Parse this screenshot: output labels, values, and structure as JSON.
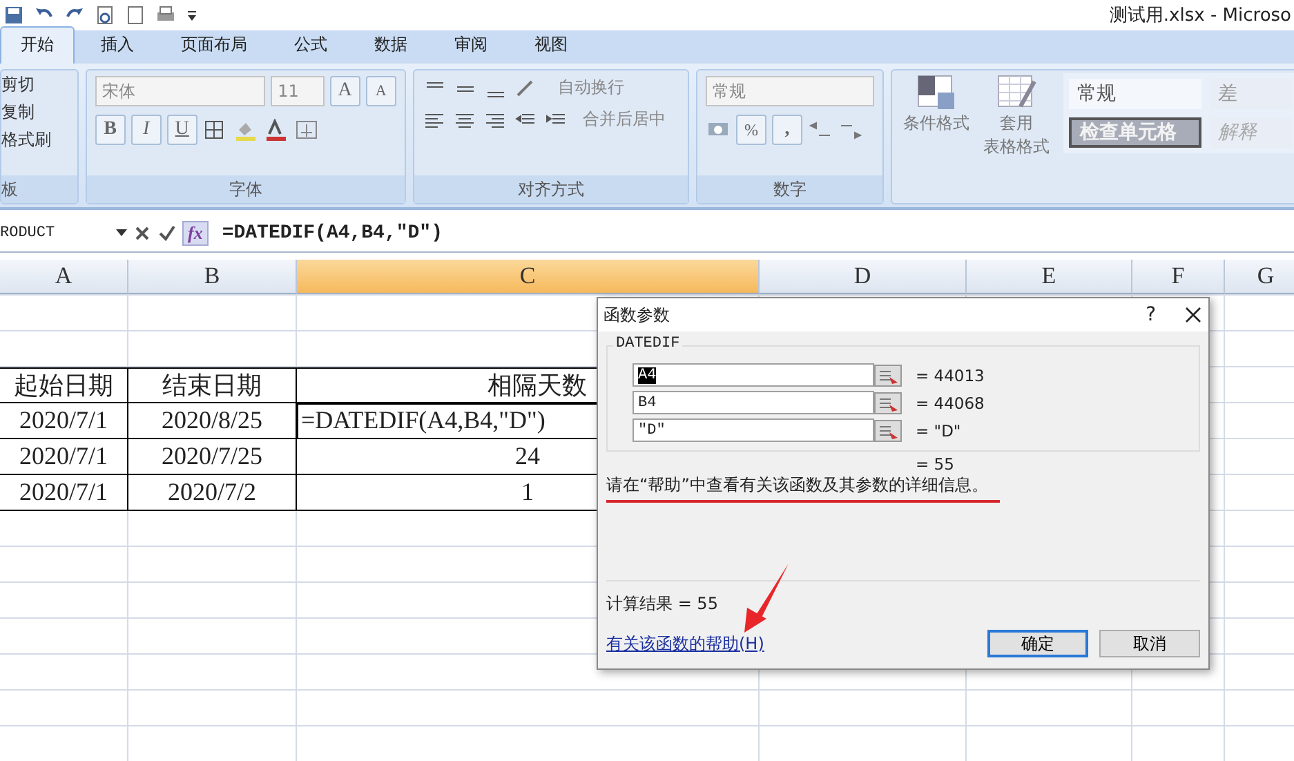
{
  "window": {
    "title": "测试用.xlsx - Microso"
  },
  "tabs": [
    {
      "label": "开始",
      "selected": true
    },
    {
      "label": "插入",
      "selected": false
    },
    {
      "label": "页面布局",
      "selected": false
    },
    {
      "label": "公式",
      "selected": false
    },
    {
      "label": "数据",
      "selected": false
    },
    {
      "label": "审阅",
      "selected": false
    },
    {
      "label": "视图",
      "selected": false
    }
  ],
  "clipboard": {
    "items": [
      "剪切",
      "复制",
      "格式刷"
    ],
    "label": "板"
  },
  "font": {
    "name": "宋体",
    "size": "11",
    "grow": "A",
    "shrink": "A",
    "styles": [
      "B",
      "I",
      "U"
    ],
    "label": "字体"
  },
  "alignment": {
    "wrap": "自动换行",
    "merge": "合并后居中",
    "label": "对齐方式"
  },
  "number": {
    "format": "常规",
    "percent": "%",
    "comma": ",",
    "label": "数字"
  },
  "styles": {
    "conditional": "条件格式",
    "table": [
      "套用",
      "表格格式"
    ],
    "gallery": [
      {
        "label": "常规",
        "kind": "normal"
      },
      {
        "label": "差",
        "kind": "bad"
      },
      {
        "label": "检查单元格",
        "kind": "check"
      },
      {
        "label": "解释",
        "kind": "note"
      }
    ]
  },
  "formula_bar": {
    "name_box": "RODUCT",
    "fx": "fx",
    "formula": "=DATEDIF(A4,B4,\"D\")"
  },
  "sheet": {
    "columns": [
      {
        "label": "A",
        "selected": false
      },
      {
        "label": "B",
        "selected": false
      },
      {
        "label": "C",
        "selected": true
      },
      {
        "label": "D",
        "selected": false
      },
      {
        "label": "E",
        "selected": false
      },
      {
        "label": "F",
        "selected": false
      },
      {
        "label": "G",
        "selected": false
      }
    ],
    "header": {
      "start": "起始日期",
      "end": "结束日期",
      "days": "相隔天数"
    },
    "rows": [
      {
        "start": "2020/7/1",
        "end": "2020/8/25",
        "days": "=DATEDIF(A4,B4,\"D\")",
        "editing": true
      },
      {
        "start": "2020/7/1",
        "end": "2020/7/25",
        "days": "24",
        "editing": false
      },
      {
        "start": "2020/7/1",
        "end": "2020/7/2",
        "days": "1",
        "editing": false
      }
    ]
  },
  "dialog": {
    "title": "函数参数",
    "help": "?",
    "function": "DATEDIF",
    "args": [
      {
        "value": "A4",
        "result": "= 44013",
        "highlighted": true
      },
      {
        "value": "B4",
        "result": "= 44068",
        "highlighted": false
      },
      {
        "value": "\"D\"",
        "result": "= \"D\"",
        "highlighted": false
      }
    ],
    "formula_result": "= 55",
    "hint": "请在“帮助”中查看有关该函数及其参数的详细信息。",
    "calc": "计算结果 = 55",
    "help_link": "有关该函数的帮助(H)",
    "buttons": [
      {
        "label": "确定",
        "default": true
      },
      {
        "label": "取消",
        "default": false
      }
    ]
  }
}
